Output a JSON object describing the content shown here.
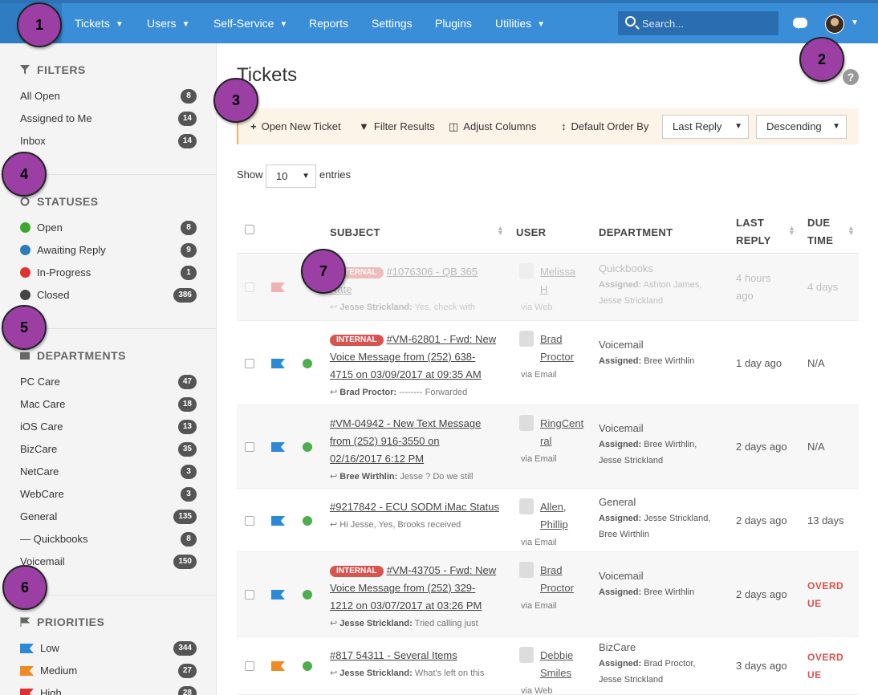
{
  "nav": {
    "items": [
      {
        "label": "Tickets",
        "chevron": true
      },
      {
        "label": "Users",
        "chevron": true
      },
      {
        "label": "Self-Service",
        "chevron": true
      },
      {
        "label": "Reports",
        "chevron": false
      },
      {
        "label": "Settings",
        "chevron": false
      },
      {
        "label": "Plugins",
        "chevron": false
      },
      {
        "label": "Utilities",
        "chevron": true
      }
    ],
    "search_placeholder": "Search...",
    "chevron_glyph": "❯"
  },
  "sidebar": {
    "filters": {
      "title": "FILTERS",
      "items": [
        {
          "label": "All Open",
          "count": "8"
        },
        {
          "label": "Assigned to Me",
          "count": "14"
        },
        {
          "label": "Inbox",
          "count": "14"
        }
      ]
    },
    "statuses": {
      "title": "STATUSES",
      "items": [
        {
          "label": "Open",
          "count": "8",
          "color": "#3aa82c"
        },
        {
          "label": "Awaiting Reply",
          "count": "9",
          "color": "#2b7db8"
        },
        {
          "label": "In-Progress",
          "count": "1",
          "color": "#e03131"
        },
        {
          "label": "Closed",
          "count": "386",
          "color": "#444444"
        }
      ]
    },
    "departments": {
      "title": "DEPARTMENTS",
      "items": [
        {
          "label": "PC Care",
          "count": "47"
        },
        {
          "label": "Mac Care",
          "count": "18"
        },
        {
          "label": "iOS Care",
          "count": "13"
        },
        {
          "label": "BizCare",
          "count": "35"
        },
        {
          "label": "NetCare",
          "count": "3"
        },
        {
          "label": "WebCare",
          "count": "3"
        },
        {
          "label": "General",
          "count": "135"
        },
        {
          "label": "— Quickbooks",
          "count": "8"
        },
        {
          "label": "Voicemail",
          "count": "150"
        }
      ]
    },
    "priorities": {
      "title": "PRIORITIES",
      "items": [
        {
          "label": "Low",
          "count": "344",
          "color": "#2b8ad8"
        },
        {
          "label": "Medium",
          "count": "27",
          "color": "#f08a24"
        },
        {
          "label": "High",
          "count": "28",
          "color": "#e03131"
        }
      ]
    }
  },
  "main": {
    "title": "Tickets",
    "help": "?",
    "toolbar": {
      "open_new": "Open New Ticket",
      "filter": "Filter Results",
      "columns": "Adjust Columns",
      "order_by": "Default Order By",
      "order_field": "Last Reply",
      "order_dir": "Descending"
    },
    "show": {
      "prefix": "Show",
      "value": "10",
      "suffix": "entries"
    },
    "columns": {
      "subject": "SUBJECT",
      "user": "USER",
      "department": "DEPARTMENT",
      "last_reply_1": "LAST",
      "last_reply_2": "REPLY",
      "due_1": "DUE",
      "due_2": "TIME"
    },
    "tag_internal": "INTERNAL",
    "tickets": [
      {
        "subject_lines": [
          "#1076306 - QB 365 Rate"
        ],
        "internal": true,
        "snippet_author": "Jesse Strickland:",
        "snippet_text": "Yes, check with",
        "user_lines": [
          "Melissa",
          "H"
        ],
        "via": "via Web",
        "dept": "Quickbooks",
        "assigned_label": "Assigned:",
        "assigned": [
          "Ashton James,",
          "Jesse Strickland"
        ],
        "last_reply": [
          "4 hours",
          "ago"
        ],
        "due": [
          "4 days"
        ],
        "due_overdue": false,
        "flag_color": "#e03131",
        "status": false
      },
      {
        "subject_lines": [
          "#VM-62801 - Fwd: New",
          "Voice Message from (252) 638-",
          "4715 on 03/09/2017 at 09:35 AM"
        ],
        "internal": true,
        "snippet_author": "Brad Proctor:",
        "snippet_text": "-------- Forwarded",
        "user_lines": [
          "Brad",
          "Proctor"
        ],
        "via": "via Email",
        "dept": "Voicemail",
        "assigned_label": "Assigned:",
        "assigned": [
          "Bree Wirthlin"
        ],
        "last_reply": [
          "1 day ago"
        ],
        "due": [
          "N/A"
        ],
        "due_overdue": false,
        "flag_color": "#2b8ad8",
        "status": true
      },
      {
        "subject_lines": [
          "#VM-04942 - New Text Message",
          "from (252) 916-3550 on",
          "02/16/2017 6:12 PM"
        ],
        "internal": false,
        "snippet_author": "Bree Wirthlin:",
        "snippet_text": "Jesse ? Do we still",
        "user_lines": [
          "RingCent",
          "ral"
        ],
        "via": "via Email",
        "dept": "Voicemail",
        "assigned_label": "Assigned:",
        "assigned": [
          "Bree Wirthlin,",
          "Jesse Strickland"
        ],
        "last_reply": [
          "2 days ago"
        ],
        "due": [
          "N/A"
        ],
        "due_overdue": false,
        "flag_color": "#2b8ad8",
        "status": true
      },
      {
        "subject_lines": [
          "#9217842 - ECU SODM iMac Status"
        ],
        "internal": false,
        "snippet_author": "",
        "snippet_text": "Hi Jesse, Yes, Brooks received",
        "user_lines": [
          "Allen,",
          "Phillip"
        ],
        "via": "via Email",
        "dept": "General",
        "assigned_label": "Assigned:",
        "assigned": [
          "Jesse Strickland,",
          "Bree Wirthlin"
        ],
        "last_reply": [
          "2 days ago"
        ],
        "due": [
          "13 days"
        ],
        "due_overdue": false,
        "flag_color": "#2b8ad8",
        "status": true
      },
      {
        "subject_lines": [
          "#VM-43705 - Fwd: New",
          "Voice Message from (252) 329-",
          "1212 on 03/07/2017 at 03:26 PM"
        ],
        "internal": true,
        "snippet_author": "Jesse Strickland:",
        "snippet_text": "Tried calling just",
        "user_lines": [
          "Brad",
          "Proctor"
        ],
        "via": "via Email",
        "dept": "Voicemail",
        "assigned_label": "Assigned:",
        "assigned": [
          "Bree Wirthlin"
        ],
        "last_reply": [
          "2 days ago"
        ],
        "due": [
          "OVERD",
          "UE"
        ],
        "due_overdue": true,
        "flag_color": "#2b8ad8",
        "status": true
      },
      {
        "subject_lines": [
          "#817 54311 - Several Items"
        ],
        "internal": false,
        "snippet_author": "Jesse Strickland:",
        "snippet_text": "What's left on this",
        "user_lines": [
          "Debbie",
          "Smiles"
        ],
        "via": "via Web",
        "dept": "BizCare",
        "assigned_label": "Assigned:",
        "assigned": [
          "Brad Proctor,",
          "Jesse Strickland"
        ],
        "last_reply": [
          "3 days ago"
        ],
        "due": [
          "OVERD",
          "UE"
        ],
        "due_overdue": true,
        "flag_color": "#f08a24",
        "status": true
      }
    ]
  },
  "markers": [
    "1",
    "2",
    "3",
    "4",
    "5",
    "6",
    "7"
  ]
}
